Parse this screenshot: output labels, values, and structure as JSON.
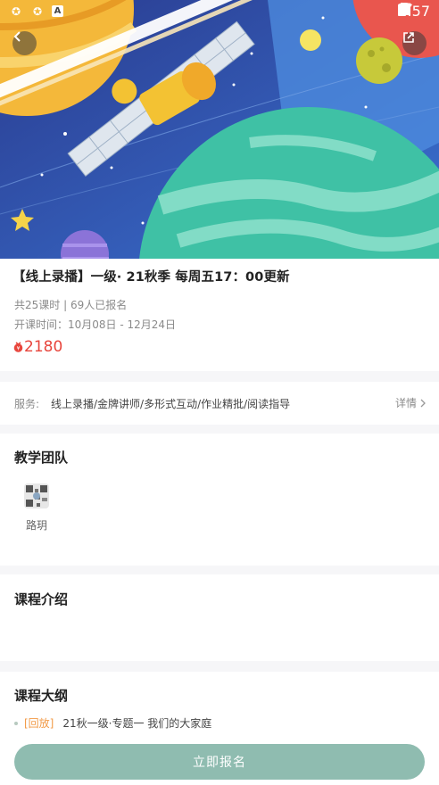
{
  "status_bar": {
    "time": "4:57",
    "left_icons": [
      "app-notification-icon",
      "app-notification-icon",
      "font-app-icon"
    ],
    "right_icons": [
      "wifi-icon",
      "signal-icon",
      "battery-icon"
    ]
  },
  "header": {
    "back_icon": "back-arrow-icon",
    "share_icon": "share-icon"
  },
  "course": {
    "title": "【线上录播】一级· 21秋季 每周五17：00更新",
    "meta": "共25课时 | 69人已报名",
    "dates": "开课时间：10月08日 - 12月24日",
    "price": "2180",
    "price_icon": "coin-icon"
  },
  "service": {
    "label": "服务:",
    "content": "线上录播/金牌讲师/多形式互动/作业精批/阅读指导",
    "detail_label": "详情"
  },
  "team": {
    "title": "教学团队",
    "teachers": [
      {
        "name": "路玥"
      }
    ]
  },
  "intro": {
    "title": "课程介绍"
  },
  "outline": {
    "title": "课程大纲",
    "items": [
      {
        "tag": "[回放]",
        "text": "21秋一级·专题一 我们的大家庭"
      }
    ]
  },
  "footer": {
    "enroll_label": "立即报名"
  },
  "colors": {
    "price": "#e8453c",
    "tag": "#f29a46",
    "button": "#8fbcb0",
    "banner_sky": "#2d4a9c",
    "banner_planet": "#3fc1a5"
  }
}
